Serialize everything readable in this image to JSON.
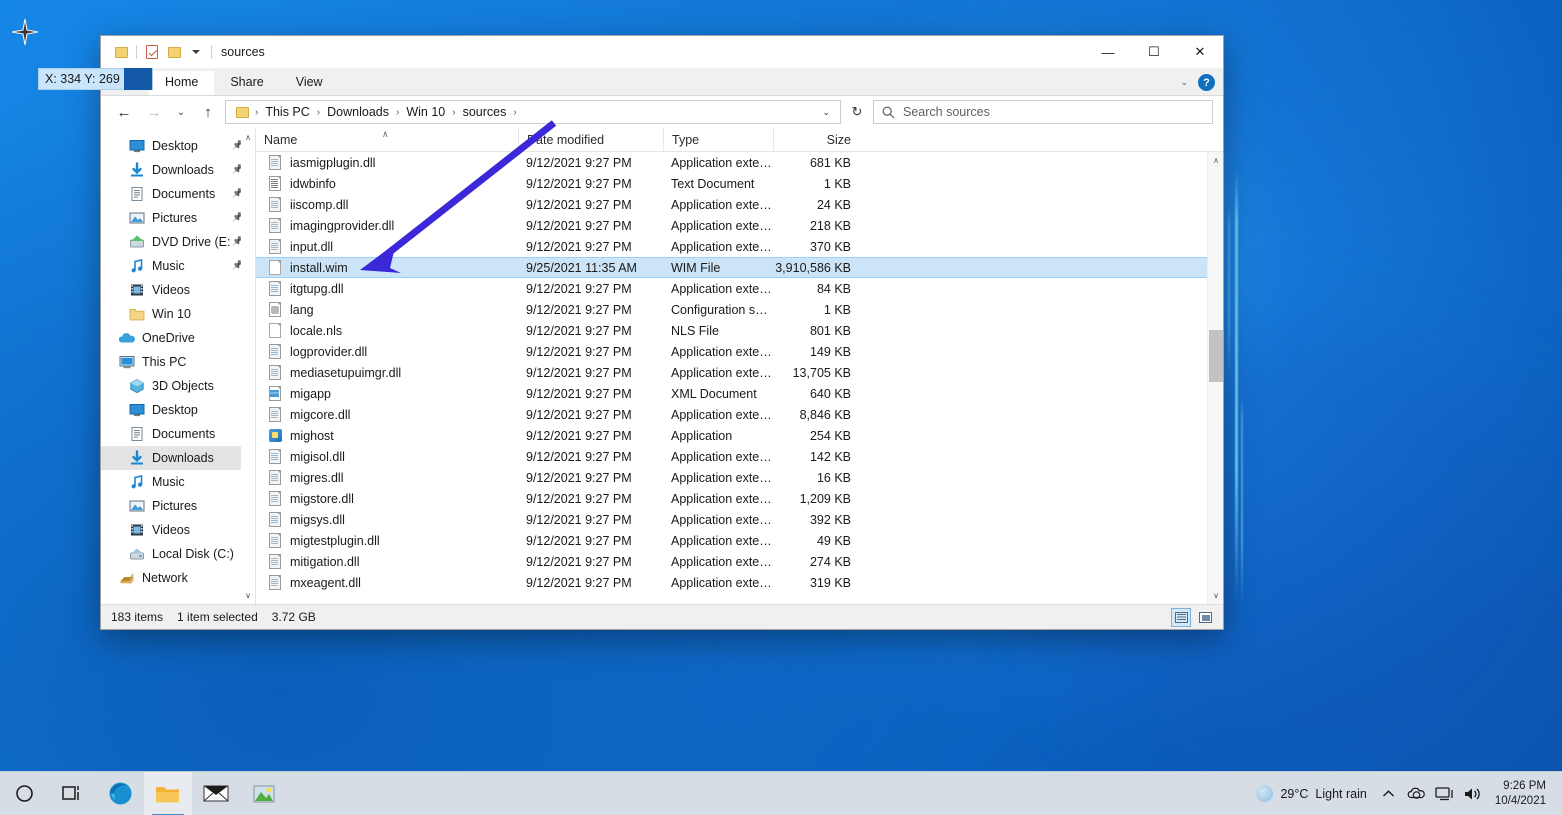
{
  "window": {
    "title": "sources",
    "quick_access": [
      "folder-icon",
      "properties-icon",
      "new-folder-icon",
      "customize-caret-icon"
    ],
    "minimize_label": "—",
    "maximize_label": "☐",
    "close_label": "✕",
    "help_label": "?"
  },
  "ribbon": {
    "tabs": [
      {
        "label": "Home",
        "active": true
      },
      {
        "label": "Share",
        "active": false
      },
      {
        "label": "View",
        "active": false
      }
    ],
    "collapse_caret": "⌄"
  },
  "address": {
    "back_label": "←",
    "forward_label": "→",
    "recent_label": "⌄",
    "up_label": "↑",
    "crumbs": [
      "This PC",
      "Downloads",
      "Win 10",
      "sources"
    ],
    "separator": "›",
    "dropdown_caret": "⌄",
    "refresh_label": "↻"
  },
  "search": {
    "placeholder": "Search sources",
    "value": "",
    "icon": "search-icon"
  },
  "nav_pane": {
    "items": [
      {
        "label": "Desktop",
        "icon": "desktop-icon",
        "pinned": true,
        "indent": 1,
        "selected": false
      },
      {
        "label": "Downloads",
        "icon": "download-icon",
        "pinned": true,
        "indent": 1,
        "selected": false
      },
      {
        "label": "Documents",
        "icon": "document-icon",
        "pinned": true,
        "indent": 1,
        "selected": false
      },
      {
        "label": "Pictures",
        "icon": "pictures-icon",
        "pinned": true,
        "indent": 1,
        "selected": false
      },
      {
        "label": "DVD Drive (E:",
        "icon": "dvd-icon",
        "pinned": true,
        "indent": 1,
        "selected": false
      },
      {
        "label": "Music",
        "icon": "music-icon",
        "pinned": true,
        "indent": 1,
        "selected": false
      },
      {
        "label": "Videos",
        "icon": "videos-icon",
        "pinned": false,
        "indent": 1,
        "selected": false
      },
      {
        "label": "Win 10",
        "icon": "folder-icon",
        "pinned": false,
        "indent": 1,
        "selected": false
      },
      {
        "label": "OneDrive",
        "icon": "onedrive-icon",
        "pinned": false,
        "indent": 0,
        "selected": false
      },
      {
        "label": "This PC",
        "icon": "thispc-icon",
        "pinned": false,
        "indent": 0,
        "selected": false
      },
      {
        "label": "3D Objects",
        "icon": "3dobjects-icon",
        "pinned": false,
        "indent": 1,
        "selected": false
      },
      {
        "label": "Desktop",
        "icon": "desktop-icon",
        "pinned": false,
        "indent": 1,
        "selected": false
      },
      {
        "label": "Documents",
        "icon": "document-icon",
        "pinned": false,
        "indent": 1,
        "selected": false
      },
      {
        "label": "Downloads",
        "icon": "download-icon",
        "pinned": false,
        "indent": 1,
        "selected": true
      },
      {
        "label": "Music",
        "icon": "music-icon",
        "pinned": false,
        "indent": 1,
        "selected": false
      },
      {
        "label": "Pictures",
        "icon": "pictures-icon",
        "pinned": false,
        "indent": 1,
        "selected": false
      },
      {
        "label": "Videos",
        "icon": "videos-icon",
        "pinned": false,
        "indent": 1,
        "selected": false
      },
      {
        "label": "Local Disk (C:)",
        "icon": "harddisk-icon",
        "pinned": false,
        "indent": 1,
        "selected": false
      },
      {
        "label": "Network",
        "icon": "network-icon",
        "pinned": false,
        "indent": 0,
        "selected": false
      }
    ],
    "scroll_up": "∧",
    "scroll_down": "∨"
  },
  "file_list": {
    "columns": [
      {
        "key": "name",
        "label": "Name",
        "sorted": true,
        "sort_caret": "∧"
      },
      {
        "key": "date",
        "label": "Date modified"
      },
      {
        "key": "type",
        "label": "Type"
      },
      {
        "key": "size",
        "label": "Size"
      }
    ],
    "rows": [
      {
        "name": "iasmigplugin.dll",
        "date": "9/12/2021 9:27 PM",
        "type": "Application exten...",
        "size": "681 KB",
        "icon": "dll",
        "selected": false
      },
      {
        "name": "idwbinfo",
        "date": "9/12/2021 9:27 PM",
        "type": "Text Document",
        "size": "1 KB",
        "icon": "txt",
        "selected": false
      },
      {
        "name": "iiscomp.dll",
        "date": "9/12/2021 9:27 PM",
        "type": "Application exten...",
        "size": "24 KB",
        "icon": "dll",
        "selected": false
      },
      {
        "name": "imagingprovider.dll",
        "date": "9/12/2021 9:27 PM",
        "type": "Application exten...",
        "size": "218 KB",
        "icon": "dll",
        "selected": false
      },
      {
        "name": "input.dll",
        "date": "9/12/2021 9:27 PM",
        "type": "Application exten...",
        "size": "370 KB",
        "icon": "dll",
        "selected": false
      },
      {
        "name": "install.wim",
        "date": "9/25/2021 11:35 AM",
        "type": "WIM File",
        "size": "3,910,586 KB",
        "icon": "wim",
        "selected": true
      },
      {
        "name": "itgtupg.dll",
        "date": "9/12/2021 9:27 PM",
        "type": "Application exten...",
        "size": "84 KB",
        "icon": "dll",
        "selected": false
      },
      {
        "name": "lang",
        "date": "9/12/2021 9:27 PM",
        "type": "Configuration sett...",
        "size": "1 KB",
        "icon": "cfg",
        "selected": false
      },
      {
        "name": "locale.nls",
        "date": "9/12/2021 9:27 PM",
        "type": "NLS File",
        "size": "801 KB",
        "icon": "wim",
        "selected": false
      },
      {
        "name": "logprovider.dll",
        "date": "9/12/2021 9:27 PM",
        "type": "Application exten...",
        "size": "149 KB",
        "icon": "dll",
        "selected": false
      },
      {
        "name": "mediasetupuimgr.dll",
        "date": "9/12/2021 9:27 PM",
        "type": "Application exten...",
        "size": "13,705 KB",
        "icon": "dll",
        "selected": false
      },
      {
        "name": "migapp",
        "date": "9/12/2021 9:27 PM",
        "type": "XML Document",
        "size": "640 KB",
        "icon": "xml",
        "selected": false
      },
      {
        "name": "migcore.dll",
        "date": "9/12/2021 9:27 PM",
        "type": "Application exten...",
        "size": "8,846 KB",
        "icon": "dll",
        "selected": false
      },
      {
        "name": "mighost",
        "date": "9/12/2021 9:27 PM",
        "type": "Application",
        "size": "254 KB",
        "icon": "app",
        "selected": false
      },
      {
        "name": "migisol.dll",
        "date": "9/12/2021 9:27 PM",
        "type": "Application exten...",
        "size": "142 KB",
        "icon": "dll",
        "selected": false
      },
      {
        "name": "migres.dll",
        "date": "9/12/2021 9:27 PM",
        "type": "Application exten...",
        "size": "16 KB",
        "icon": "dll",
        "selected": false
      },
      {
        "name": "migstore.dll",
        "date": "9/12/2021 9:27 PM",
        "type": "Application exten...",
        "size": "1,209 KB",
        "icon": "dll",
        "selected": false
      },
      {
        "name": "migsys.dll",
        "date": "9/12/2021 9:27 PM",
        "type": "Application exten...",
        "size": "392 KB",
        "icon": "dll",
        "selected": false
      },
      {
        "name": "migtestplugin.dll",
        "date": "9/12/2021 9:27 PM",
        "type": "Application exten...",
        "size": "49 KB",
        "icon": "dll",
        "selected": false
      },
      {
        "name": "mitigation.dll",
        "date": "9/12/2021 9:27 PM",
        "type": "Application exten...",
        "size": "274 KB",
        "icon": "dll",
        "selected": false
      },
      {
        "name": "mxeagent.dll",
        "date": "9/12/2021 9:27 PM",
        "type": "Application exten...",
        "size": "319 KB",
        "icon": "dll",
        "selected": false
      }
    ],
    "scroll_up": "∧",
    "scroll_down": "∨"
  },
  "status_bar": {
    "item_count": "183 items",
    "selection": "1 item selected",
    "selection_size": "3.72 GB",
    "view_details_icon": "details-view-icon",
    "view_large_icon": "large-icons-view-icon"
  },
  "annotation": {
    "arrow_color": "#3b28d8",
    "coord_tooltip": "X: 334 Y: 269"
  },
  "taskbar": {
    "items": [
      {
        "icon": "cortana-icon",
        "active": false
      },
      {
        "icon": "task-view-icon",
        "active": false
      },
      {
        "icon": "edge-icon",
        "active": false
      },
      {
        "icon": "file-explorer-icon",
        "active": true
      },
      {
        "icon": "mail-icon",
        "active": false
      },
      {
        "icon": "photos-icon",
        "active": false
      }
    ],
    "weather_temp": "29°C",
    "weather_desc": "Light rain",
    "tray": [
      {
        "icon": "show-hidden-icons-chevron",
        "glyph": "⌃"
      },
      {
        "icon": "onedrive-tray-icon",
        "glyph": "☁"
      },
      {
        "icon": "network-tray-icon",
        "glyph": "⌨"
      },
      {
        "icon": "volume-tray-icon",
        "glyph": "◂))"
      }
    ],
    "clock_time": "9:26 PM",
    "clock_date": "10/4/2021"
  }
}
